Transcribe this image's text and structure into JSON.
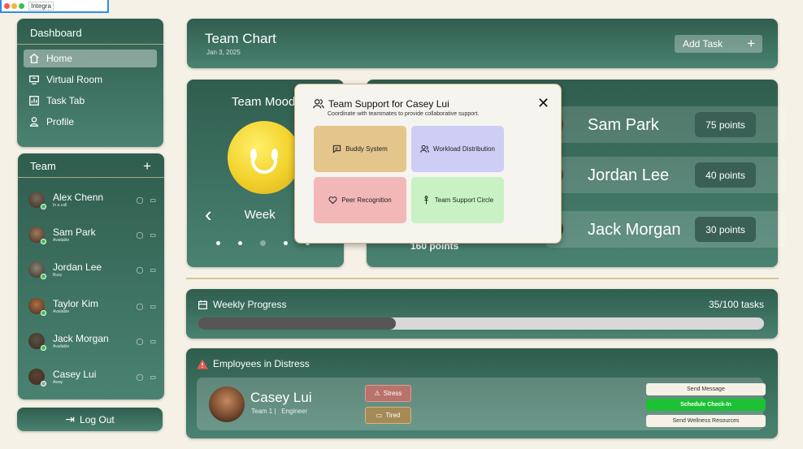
{
  "window": {
    "title": "Integra",
    "colors": [
      "#ee5b52",
      "#f4b43c",
      "#3fbf4c"
    ]
  },
  "nav": {
    "title": "Dashboard",
    "items": [
      {
        "label": "Home",
        "icon": "home-icon",
        "active": true
      },
      {
        "label": "Virtual Room",
        "icon": "monitor-icon"
      },
      {
        "label": "Task Tab",
        "icon": "chart-icon"
      },
      {
        "label": "Profile",
        "icon": "user-icon"
      }
    ]
  },
  "team": {
    "title": "Team",
    "add_symbol": "+",
    "members": [
      {
        "name": "Alex Chenn",
        "status": "In a call",
        "status_color": "#38c24f",
        "avatar_color": "#7c6a5b"
      },
      {
        "name": "Sam Park",
        "status": "Available",
        "status_color": "#38c24f",
        "avatar_color": "#a17a57"
      },
      {
        "name": "Jordan Lee",
        "status": "Busy",
        "status_color": "#38c24f",
        "avatar_color": "#8c8478"
      },
      {
        "name": "Taylor Kim",
        "status": "Available",
        "status_color": "#38c24f",
        "avatar_color": "#b46e3e"
      },
      {
        "name": "Jack Morgan",
        "status": "Available",
        "status_color": "#38c24f",
        "avatar_color": "#5b5144"
      },
      {
        "name": "Casey Lui",
        "status": "Away",
        "status_color": "#9aa8a4",
        "avatar_color": "#5d4332"
      }
    ]
  },
  "logout": {
    "label": "Log Out"
  },
  "header": {
    "title": "Team Chart",
    "date": "Jan 3, 2025",
    "add_task": "Add Task",
    "add_symbol": "+"
  },
  "mood": {
    "title": "Team Mood",
    "period": "Week",
    "prev_symbol": "‹",
    "page_count": 5,
    "selected_page": 2
  },
  "leaderboard": {
    "rows": [
      {
        "name": "Sam Park",
        "points": "75 points",
        "avatar_color": "#a17a57"
      },
      {
        "name": "Jordan Lee",
        "points": "40 points",
        "avatar_color": "#8c8478"
      },
      {
        "name": "Jack Morgan",
        "points": "30 points",
        "avatar_color": "#5b5144"
      }
    ],
    "total": "160 points"
  },
  "progress": {
    "title": "Weekly Progress",
    "count": "35/100 tasks",
    "fraction": 0.35
  },
  "distress": {
    "title": "Employees in Distress",
    "employee": {
      "name": "Casey Lui",
      "meta": "Team 1 |   Engineer"
    },
    "tags": [
      {
        "label": "Stress",
        "icon": "warning-icon"
      },
      {
        "label": "Tired",
        "icon": "battery-icon"
      }
    ],
    "actions": [
      "Send Message",
      "Schedule Check-In",
      "Send Wellness Resources"
    ],
    "accent": "#e05a4f"
  },
  "modal": {
    "title": "Team Support for Casey Lui",
    "subtitle": "Coordinate with teammates to provide collaborative support.",
    "close_symbol": "✕",
    "options": [
      {
        "label": "Buddy System",
        "color": "#e4c58c",
        "icon": "chat-icon"
      },
      {
        "label": "Workload Distribution",
        "color": "#cdcdf5",
        "icon": "users-icon"
      },
      {
        "label": "Peer Recognition",
        "color": "#f2b8b8",
        "icon": "heart-icon"
      },
      {
        "label": "Team Support Circle",
        "color": "#c9f2c4",
        "icon": "person-icon"
      }
    ]
  }
}
